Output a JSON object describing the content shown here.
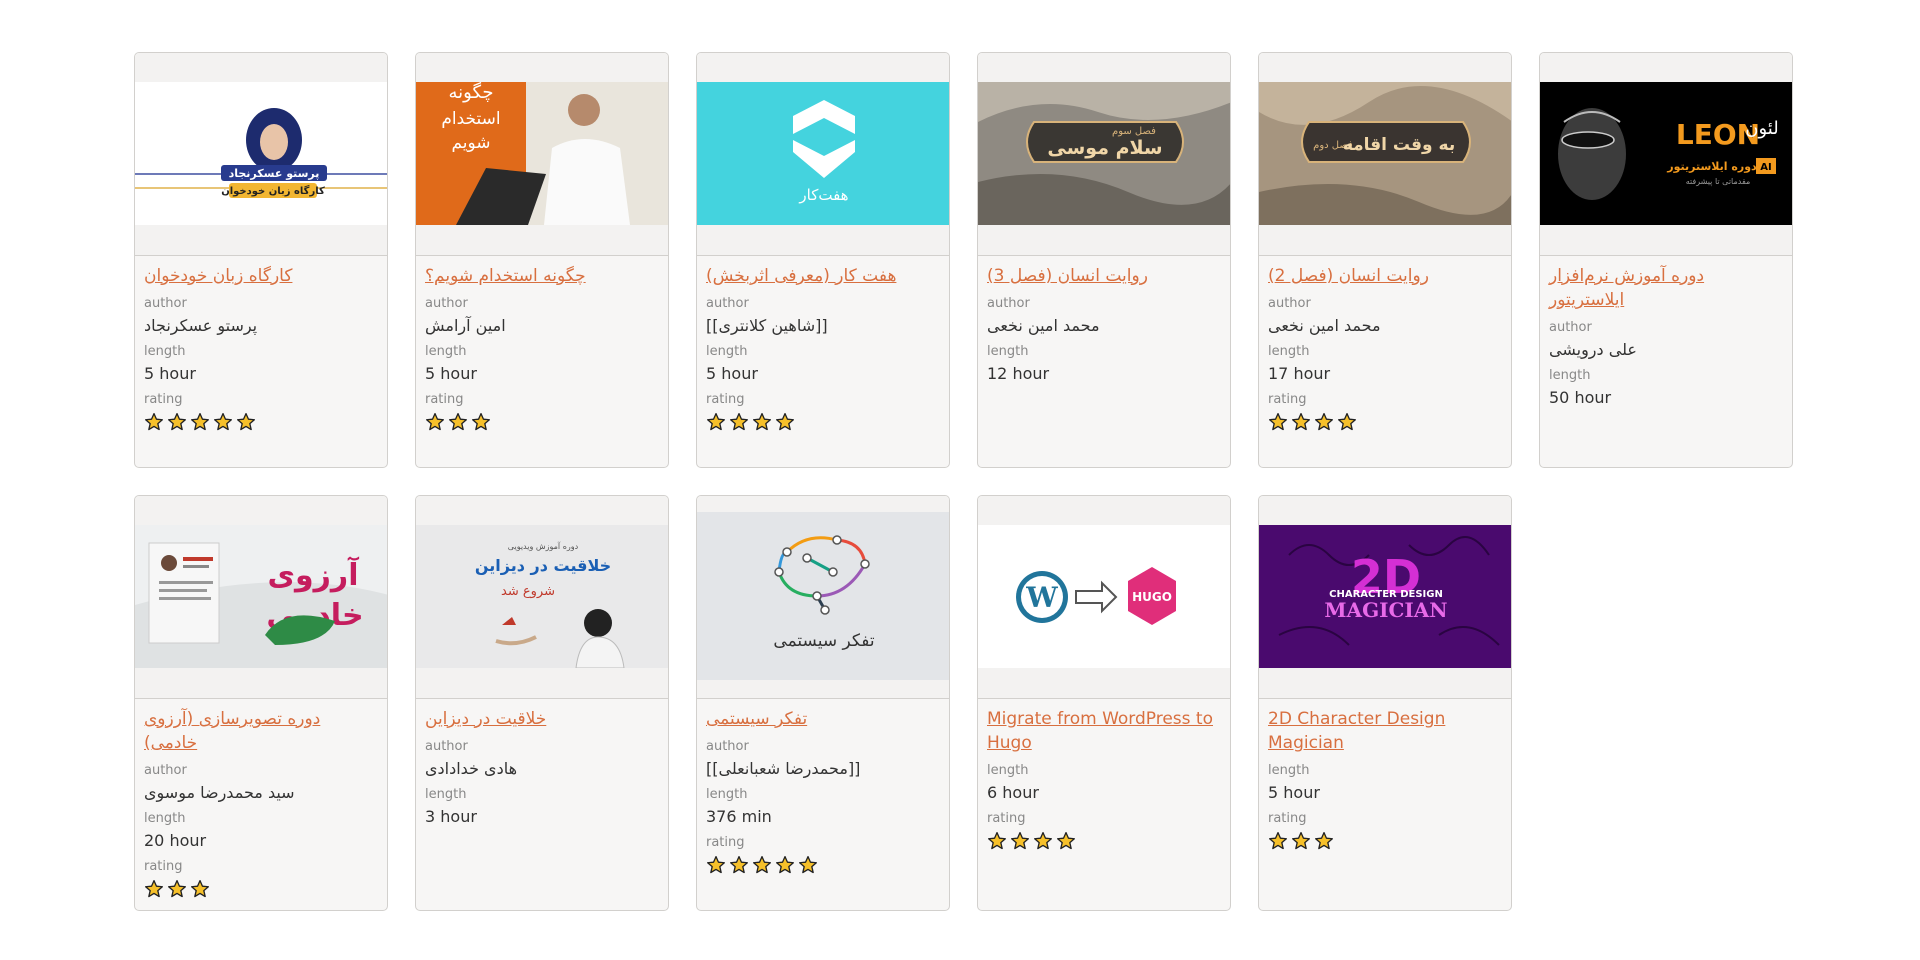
{
  "labels": {
    "author": "author",
    "length": "length",
    "rating": "rating"
  },
  "colors": {
    "link": "#d86f3f",
    "star_fill": "#f6c02a",
    "star_stroke": "#222222"
  },
  "courses": [
    {
      "title": "کارگاه زبان خودخوان",
      "author": "پرستو عسکرنجاد",
      "length": "5 hour",
      "rating": 5,
      "thumb_text": [
        "پرستو عسکرنجاد",
        "کارگاه زبان خودخوان"
      ]
    },
    {
      "title": "چگونه استخدام شویم؟",
      "author": "امین آرامش",
      "length": "5 hour",
      "rating": 3,
      "thumb_text": [
        "چگونه",
        "استخدام",
        "شویم"
      ]
    },
    {
      "title": "هفت کار (معرفی اثربخش)",
      "author": "[[شاهین کلانتری]]",
      "length": "5 hour",
      "rating": 4,
      "thumb_text": [
        "هفت‌کار"
      ]
    },
    {
      "title": "روایت انسان (فصل 3)",
      "author": "محمد امین نخعی",
      "length": "12 hour",
      "rating": null,
      "thumb_text": [
        "فصل سوم",
        "سلام موسی"
      ]
    },
    {
      "title": "روایت انسان (فصل 2)",
      "author": "محمد امین نخعی",
      "length": "17 hour",
      "rating": 4,
      "thumb_text": [
        "فصل دوم",
        "به وقت اقامه"
      ]
    },
    {
      "title": "دوره آموزش نرم‌افزار ایلاستریتور",
      "author": "علی درویشی",
      "length": "50 hour",
      "rating": null,
      "thumb_text": [
        "LEON",
        "لئون",
        "AI",
        "دوره ایلاستریتور",
        "مقدماتی تا پیشرفته"
      ]
    },
    {
      "title": "دوره تصویرسازی (آرزوی خادمی)",
      "author": "سید محمدرضا موسوی",
      "length": "20 hour",
      "rating": 3,
      "thumb_text": [
        "آرزوی",
        "خادمی"
      ]
    },
    {
      "title": "خلاقیت در دیزاین",
      "author": "هادی خدادادی",
      "length": "3 hour",
      "rating": null,
      "thumb_text": [
        "دوره آموزش ویدیویی",
        "خلاقیت در دیزاین",
        "شروع شد"
      ]
    },
    {
      "title": "تفکر سیستمی",
      "author": "[[محمدرضا شعبانعلی]]",
      "length": "376 min",
      "rating": 5,
      "thumb_text": [
        "تفکر سیستمی"
      ]
    },
    {
      "title": "Migrate from WordPress to Hugo",
      "author": null,
      "length": "6 hour",
      "rating": 4,
      "thumb_text": [
        "HUGO"
      ]
    },
    {
      "title": "2D Character Design Magician",
      "author": null,
      "length": "5 hour",
      "rating": 3,
      "thumb_text": [
        "2D",
        "CHARACTER DESIGN",
        "MAGICIAN"
      ]
    }
  ]
}
